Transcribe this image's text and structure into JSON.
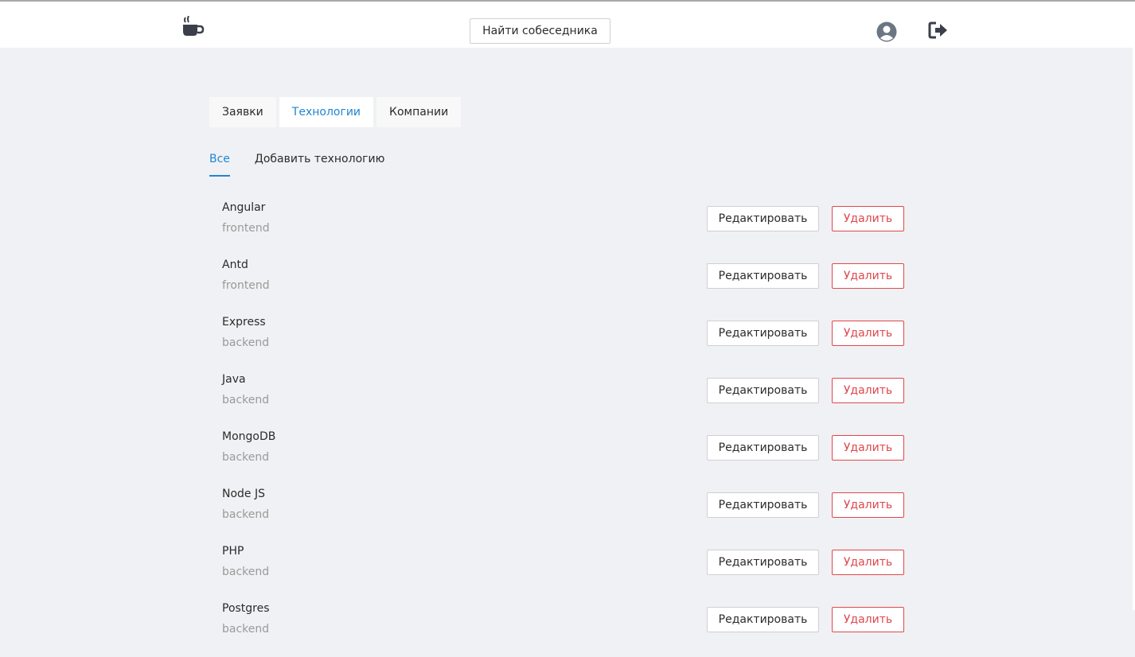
{
  "header": {
    "logo_icon": "coffee-cup-icon",
    "find_button_label": "Найти собеседника",
    "profile_icon": "user-avatar-icon",
    "logout_icon": "logout-icon"
  },
  "tabs": [
    {
      "label": "Заявки",
      "active": false
    },
    {
      "label": "Технологии",
      "active": true
    },
    {
      "label": "Компании",
      "active": false
    }
  ],
  "subtabs": [
    {
      "label": "Все",
      "active": true
    },
    {
      "label": "Добавить технологию",
      "active": false
    }
  ],
  "actions": {
    "edit_label": "Редактировать",
    "delete_label": "Удалить"
  },
  "technologies": [
    {
      "name": "Angular",
      "category": "frontend"
    },
    {
      "name": "Antd",
      "category": "frontend"
    },
    {
      "name": "Express",
      "category": "backend"
    },
    {
      "name": "Java",
      "category": "backend"
    },
    {
      "name": "MongoDB",
      "category": "backend"
    },
    {
      "name": "Node JS",
      "category": "backend"
    },
    {
      "name": "PHP",
      "category": "backend"
    },
    {
      "name": "Postgres",
      "category": "backend"
    }
  ],
  "colors": {
    "accent": "#1f86d3",
    "danger": "#e0474c",
    "background": "#f0f1f4",
    "icon": "#3a3f4b"
  }
}
